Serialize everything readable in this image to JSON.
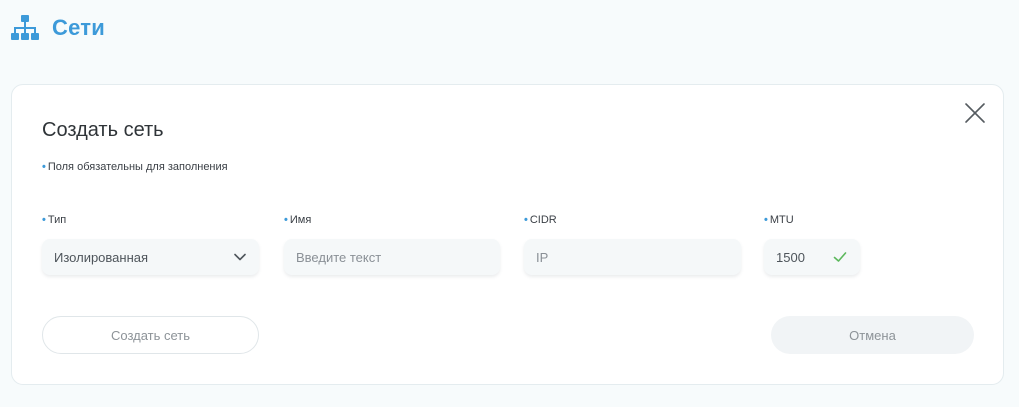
{
  "header": {
    "icon": "network-icon",
    "title": "Сети"
  },
  "form": {
    "title": "Создать сеть",
    "required_note": "Поля обязательны для заполнения",
    "close_icon": "close-icon",
    "fields": {
      "type": {
        "label": "Тип",
        "value": "Изолированная",
        "icon": "chevron-down-icon"
      },
      "name": {
        "label": "Имя",
        "placeholder": "Введите текст",
        "value": ""
      },
      "cidr": {
        "label": "CIDR",
        "placeholder": "IP",
        "value": ""
      },
      "mtu": {
        "label": "MTU",
        "value": "1500",
        "icon": "checkmark-icon"
      }
    },
    "buttons": {
      "create": "Создать сеть",
      "cancel": "Отмена"
    }
  },
  "colors": {
    "accent": "#3d9ad9",
    "success": "#5cb85c",
    "background": "#f7fbfc",
    "card": "#ffffff"
  }
}
